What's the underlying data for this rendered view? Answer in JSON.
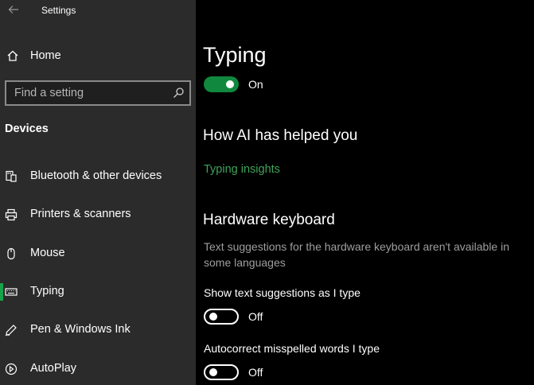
{
  "window": {
    "title": "Settings"
  },
  "sidebar": {
    "home_label": "Home",
    "search_placeholder": "Find a setting",
    "section_title": "Devices",
    "items": [
      {
        "label": "Bluetooth & other devices",
        "icon": "bluetooth-devices-icon"
      },
      {
        "label": "Printers & scanners",
        "icon": "printer-icon"
      },
      {
        "label": "Mouse",
        "icon": "mouse-icon"
      },
      {
        "label": "Typing",
        "icon": "keyboard-icon",
        "active": true
      },
      {
        "label": "Pen & Windows Ink",
        "icon": "pen-icon"
      },
      {
        "label": "AutoPlay",
        "icon": "autoplay-icon"
      }
    ]
  },
  "main": {
    "title": "Typing",
    "typing_toggle": {
      "state": "On",
      "on": true
    },
    "ai_heading": "How AI has helped you",
    "insights_link": "Typing insights",
    "hardware_heading": "Hardware keyboard",
    "hardware_desc": "Text suggestions for the hardware keyboard aren't available in some languages",
    "settings": [
      {
        "label": "Show text suggestions as I type",
        "state": "Off",
        "on": false
      },
      {
        "label": "Autocorrect misspelled words I type",
        "state": "Off",
        "on": false
      }
    ]
  },
  "colors": {
    "accent": "#10893e",
    "link": "#3fa35a",
    "sidebar_bg": "#2b2b2b",
    "main_bg": "#000000"
  }
}
